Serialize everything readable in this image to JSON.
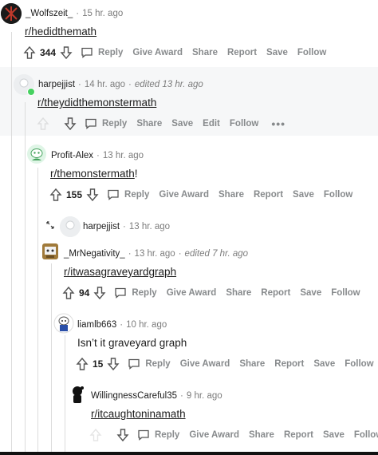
{
  "comments": [
    {
      "user": "_Wolfszeit_",
      "time": "15 hr. ago",
      "body": "r/hedidthemath",
      "score": "344"
    },
    {
      "user": "harpejjist",
      "time": "14 hr. ago",
      "edited": "edited 13 hr. ago",
      "body": "r/theydidthemonstermath"
    },
    {
      "user": "Profit-Alex",
      "time": "13 hr. ago",
      "body_link": "r/themonstermath",
      "body_suffix": "!",
      "score": "155"
    },
    {
      "user": "harpejjist",
      "time": "13 hr. ago"
    },
    {
      "user": "_MrNegativity_",
      "time": "13 hr. ago",
      "edited": "edited 7 hr. ago",
      "body": "r/itwasagraveyardgraph",
      "score": "94"
    },
    {
      "user": "liamlb663",
      "time": "10 hr. ago",
      "body": "Isn’t it graveyard graph",
      "score": "15"
    },
    {
      "user": "WillingnessCareful35",
      "time": "9 hr. ago",
      "body": "r/itcaughtoninamath"
    }
  ],
  "actions": {
    "reply": "Reply",
    "award": "Give Award",
    "share": "Share",
    "report": "Report",
    "save": "Save",
    "follow": "Follow",
    "edit": "Edit",
    "more": "•••"
  },
  "dot": "·",
  "colors": {
    "text": "#1c1c1c",
    "meta": "#7c7c7c",
    "action": "#878a8c",
    "online": "#46d160",
    "highlight": "#f6f7f8"
  }
}
